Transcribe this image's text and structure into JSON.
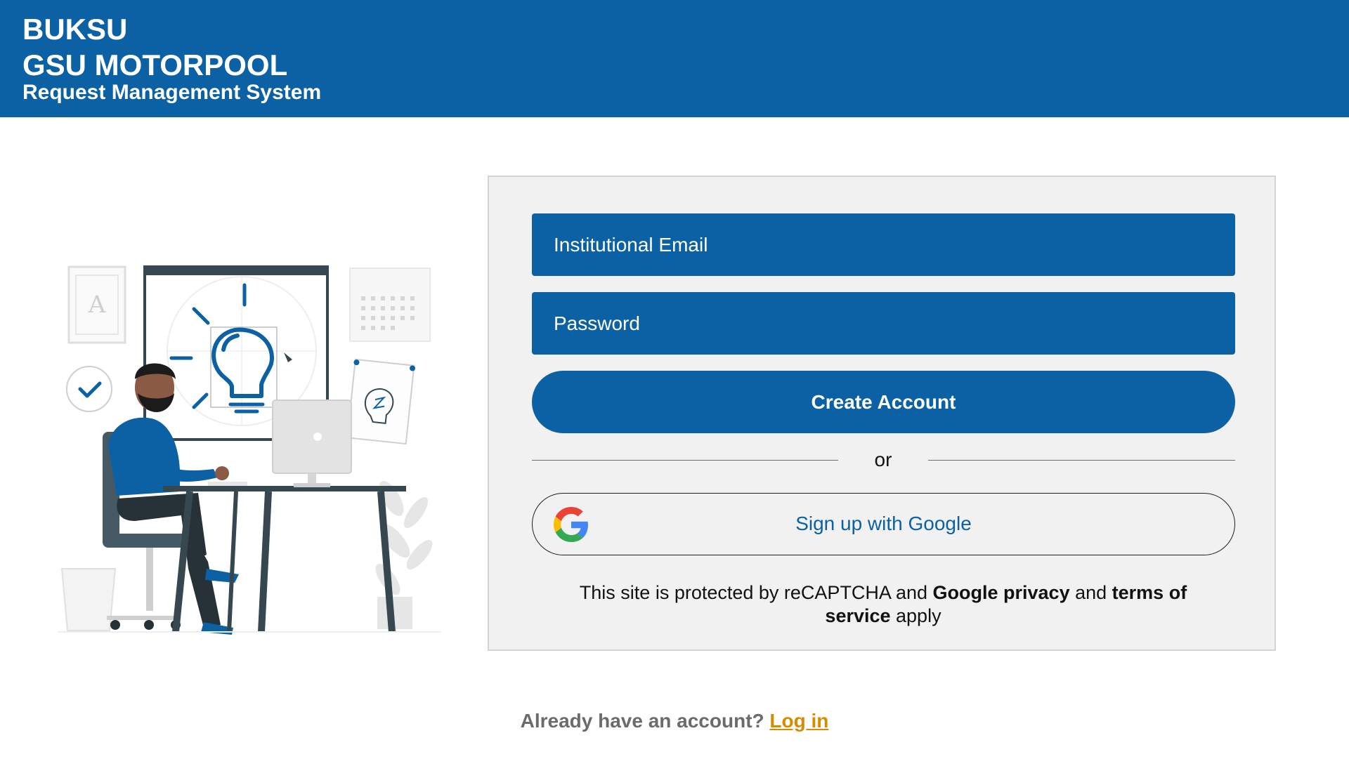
{
  "header": {
    "title_line1": "BUKSU",
    "title_line2": "GSU MOTORPOOL",
    "subtitle": "Request Management System"
  },
  "form": {
    "email_placeholder": "Institutional Email",
    "password_placeholder": "Password",
    "create_account_label": "Create Account",
    "or_text": "or",
    "google_label": "Sign up with Google",
    "recaptcha": {
      "prefix": "This site is protected by reCAPTCHA and ",
      "privacy": "Google privacy",
      "middle": " and ",
      "terms": "terms of service",
      "suffix": " apply"
    }
  },
  "footer": {
    "question": "Already have an account?",
    "login_label": "Log in"
  },
  "colors": {
    "brand_blue": "#0b61a4",
    "login_link": "#d78c00",
    "card_bg": "#f1f1f1"
  },
  "icons": {
    "google": "google-g-icon",
    "illustration": "person-at-desk-illustration"
  }
}
